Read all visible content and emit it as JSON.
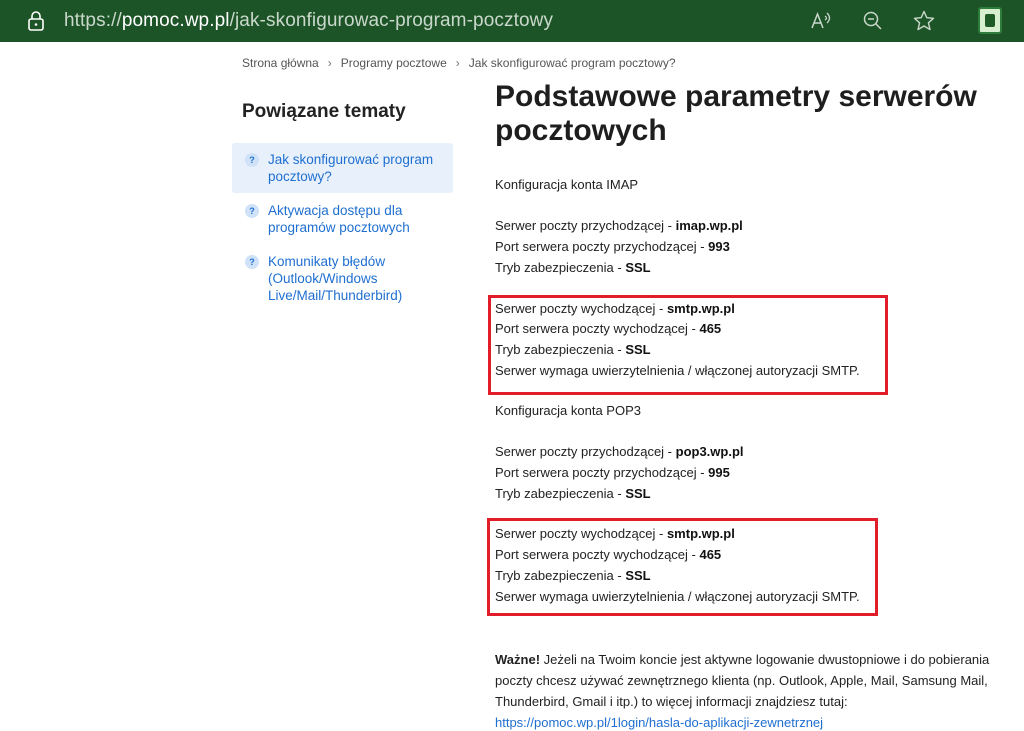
{
  "browser": {
    "url_scheme": "https://",
    "url_host": "pomoc.wp.pl",
    "url_path": "/jak-skonfigurowac-program-pocztowy",
    "accent_color": "#1d5427"
  },
  "breadcrumb": [
    "Strona główna",
    "Programy pocztowe",
    "Jak skonfigurować program pocztowy?"
  ],
  "breadcrumb_separator": "›",
  "sidebar": {
    "title": "Powiązane tematy",
    "items": [
      {
        "label": "Jak skonfigurować program pocztowy?",
        "icon": "?"
      },
      {
        "label": "Aktywacja dostępu dla programów pocztowych",
        "icon": "?"
      },
      {
        "label": "Komunikaty błędów (Outlook/Windows Live/Mail/Thunderbird)",
        "icon": "?"
      }
    ]
  },
  "main": {
    "title": "Podstawowe parametry serwerów pocztowych",
    "imap_heading": "Konfiguracja konta IMAP",
    "imap_in": {
      "server_label": "Serwer poczty przychodzącej - ",
      "server_value": "imap.wp.pl",
      "port_label": "Port serwera poczty przychodzącej - ",
      "port_value": "993",
      "security_label": "Tryb zabezpieczenia - ",
      "security_value": "SSL"
    },
    "imap_out": {
      "server_label": "Serwer poczty wychodzącej - ",
      "server_value": "smtp.wp.pl",
      "port_label": "Port serwera poczty wychodzącej - ",
      "port_value": "465",
      "security_label": "Tryb zabezpieczenia - ",
      "security_value": "SSL",
      "auth_note": "Serwer wymaga uwierzytelnienia / włączonej autoryzacji SMTP."
    },
    "pop3_heading": "Konfiguracja konta POP3",
    "pop3_in": {
      "server_label": "Serwer poczty przychodzącej - ",
      "server_value": "pop3.wp.pl",
      "port_label": "Port serwera poczty przychodzącej - ",
      "port_value": "995",
      "security_label": "Tryb zabezpieczenia - ",
      "security_value": "SSL"
    },
    "pop3_out": {
      "server_label": "Serwer poczty wychodzącej - ",
      "server_value": "smtp.wp.pl",
      "port_label": "Port serwera poczty wychodzącej - ",
      "port_value": "465",
      "security_label": "Tryb zabezpieczenia - ",
      "security_value": "SSL",
      "auth_note": "Serwer wymaga uwierzytelnienia / włączonej autoryzacji SMTP."
    },
    "important": {
      "label": "Ważne!",
      "text": " Jeżeli na Twoim koncie jest aktywne logowanie dwustopniowe i do pobierania poczty chcesz używać zewnętrznego klienta (np. Outlook, Apple, Mail, Samsung Mail, Thunderbird, Gmail i itp.) to więcej informacji znajdziesz tutaj:",
      "link": "https://pomoc.wp.pl/1login/hasla-do-aplikacji-zewnetrznej"
    },
    "highlight_color": "#e11d2a"
  }
}
